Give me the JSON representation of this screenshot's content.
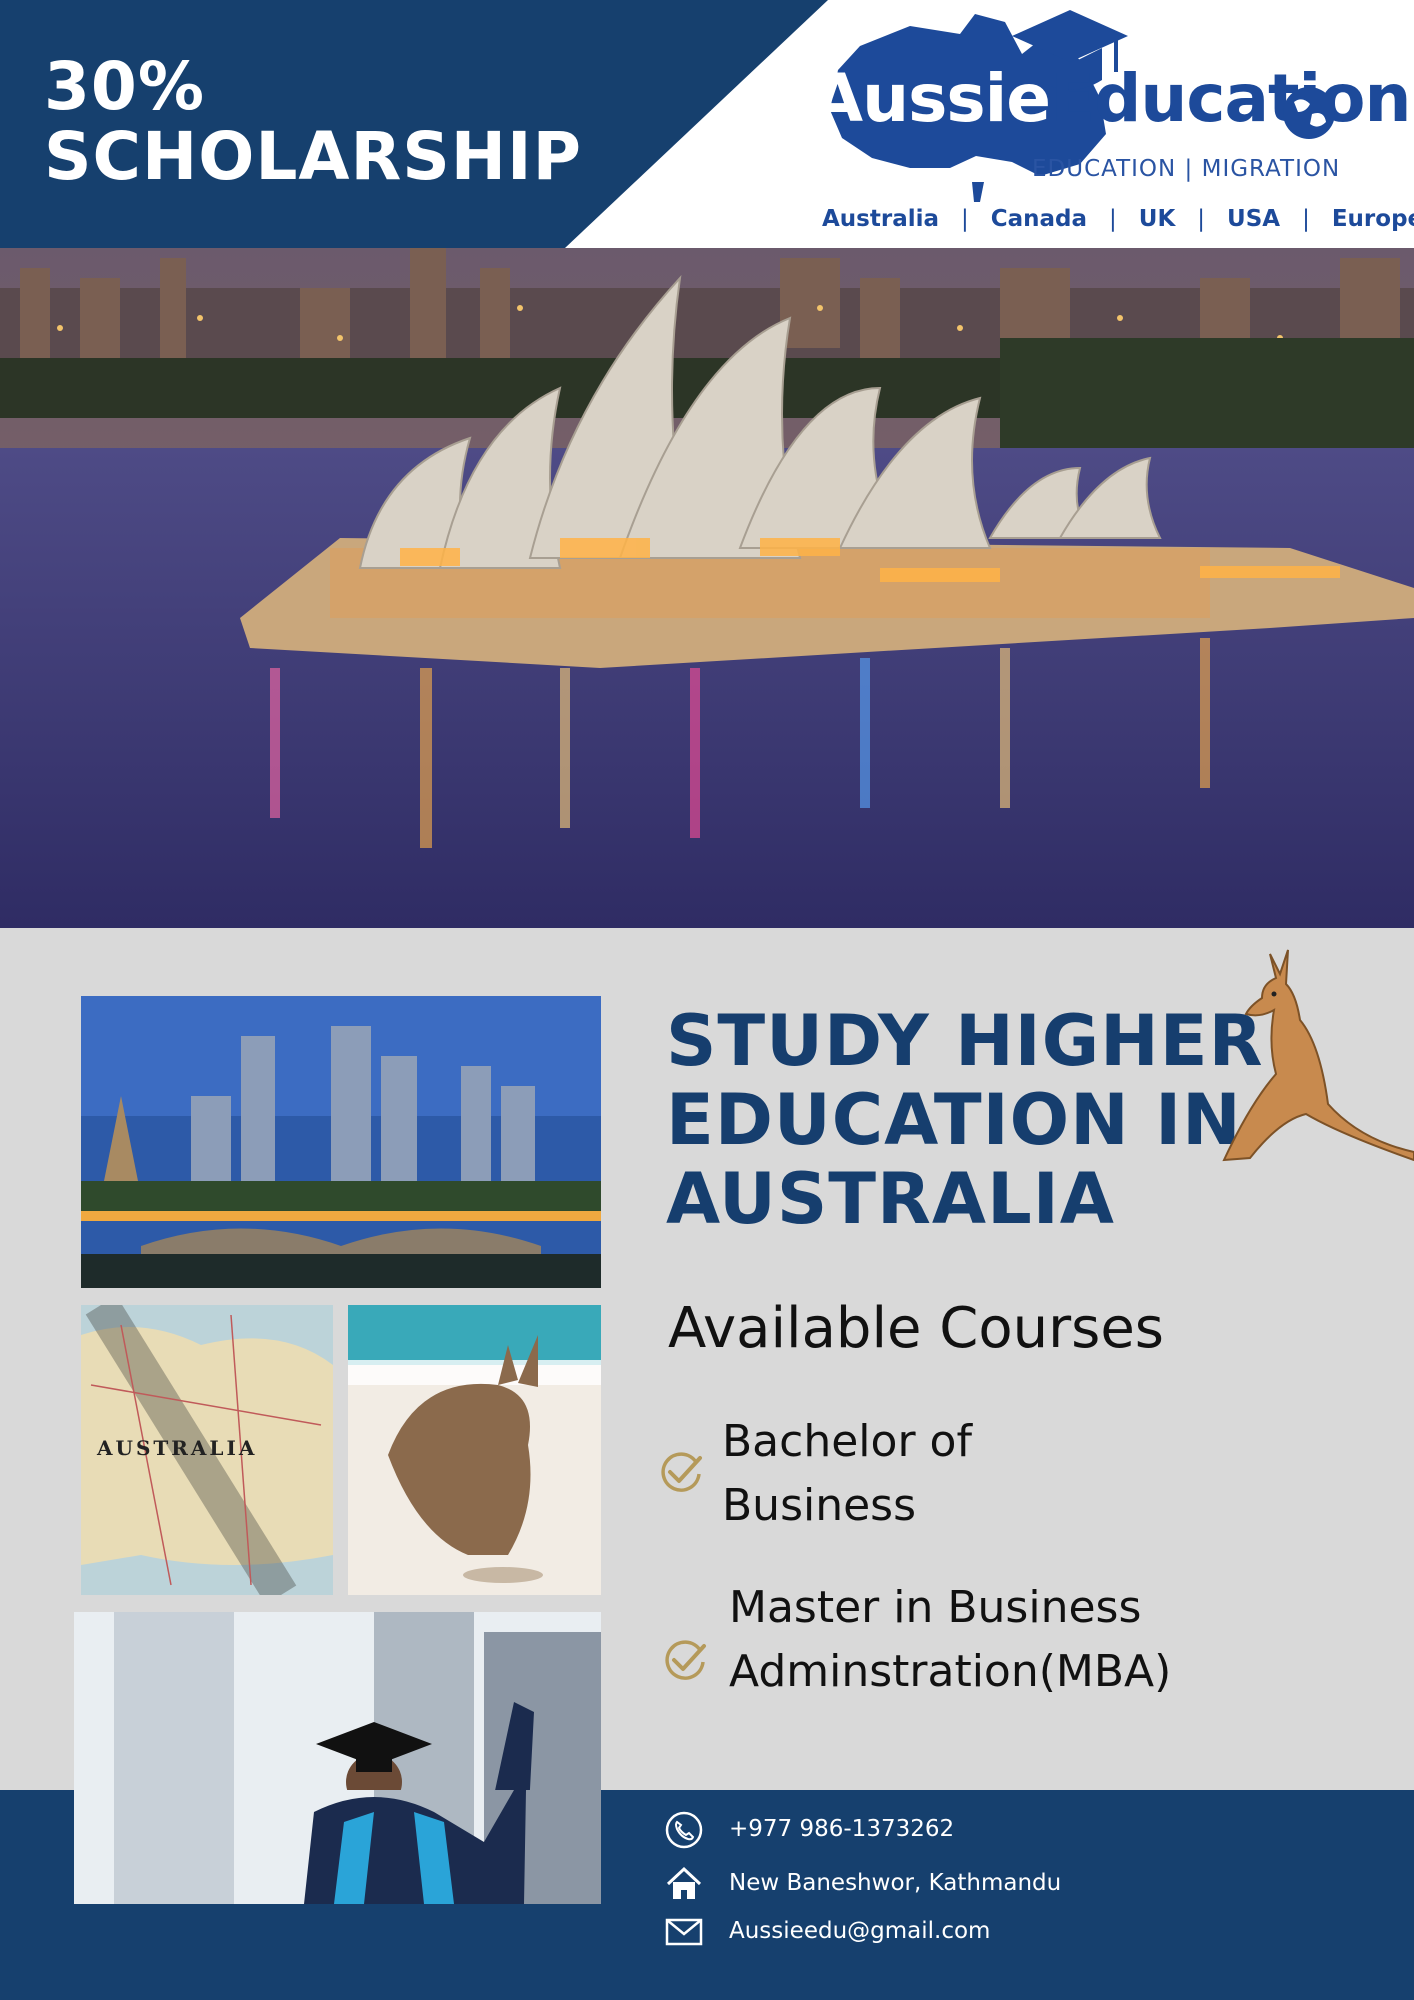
{
  "header": {
    "promo_line1": "30%",
    "promo_line2": "SCHOLARSHIP",
    "brand_part1": "Aussie",
    "brand_part2": "Education",
    "brand_tagline": "EDUCATION | MIGRATION",
    "countries": [
      "Australia",
      "Canada",
      "UK",
      "USA",
      "Europe"
    ],
    "colors": {
      "navy": "#16406e",
      "brand_blue": "#1d4a9a",
      "gold_check": "#b59a5a"
    }
  },
  "hero": {
    "image": "sydney-opera-house-night-photo"
  },
  "main": {
    "headline_line1": "STUDY HIGHER",
    "headline_line2": "EDUCATION IN",
    "headline_line3": "AUSTRALIA",
    "courses_title": "Available Courses",
    "courses": [
      {
        "line1": "Bachelor of",
        "line2": "Business"
      },
      {
        "line1": "Master in Business",
        "line2": "Adminstration(MBA)"
      }
    ],
    "photos": [
      "city-skyline-photo",
      "australia-map-photo",
      "kangaroo-beach-photo",
      "graduate-photo"
    ],
    "map_label": "AUSTRALIA"
  },
  "footer": {
    "phone": "+977 986-1373262",
    "address": "New Baneshwor, Kathmandu",
    "email": "Aussieedu@gmail.com"
  }
}
